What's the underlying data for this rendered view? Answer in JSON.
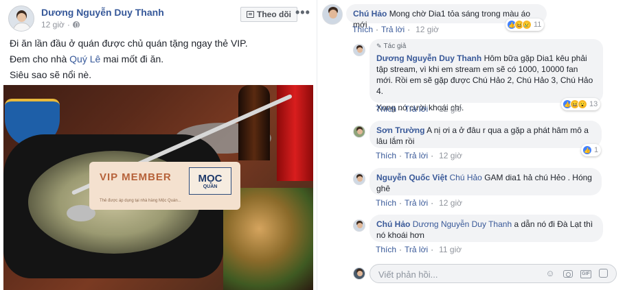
{
  "post": {
    "author": "Dương Nguyễn Duy Thanh",
    "time": "12 giờ",
    "privacy_icon": "globe-icon",
    "follow_label": "Theo dõi",
    "more_label": "•••",
    "line1": "Đi ăn lần đầu ở quán được chủ quán tặng ngay thẻ VIP.",
    "line2_prefix": "Đem cho nhà ",
    "line2_link": "Quý Lê",
    "line2_suffix": " mai mốt đi ăn.",
    "line3": "Siêu sao sẽ nổi nè.",
    "photo": {
      "card_title": "VIP MEMBER",
      "logo_line1": "MỌC",
      "logo_line2": "QUÁN",
      "card_small_text": "Thẻ được áp dụng tại nhà hàng Mộc Quán..."
    }
  },
  "comments": [
    {
      "name": "Chú Hảo",
      "text": "Mong chờ Dia1 tỏa sáng trong màu áo mới",
      "like": "Thích",
      "reply": "Trả lời",
      "time": "12 giờ",
      "reactions": [
        "like-icon",
        "haha-icon",
        "sad-icon"
      ],
      "reaction_count": "11"
    },
    {
      "badge": "Tác giả",
      "name": "Dương Nguyễn Duy Thanh",
      "text": "Hôm bữa gặp Dia1 kêu phải tập stream, vì khi em stream em sẽ có 1000, 10000 fan mới. Rồi em sẽ gặp được Chú Hảo 2, Chú Hảo 3, Chú Hảo 4.",
      "text2": "Xong nó cười khoái chí.",
      "like": "Thích",
      "reply": "Trả lời",
      "time": "12 giờ",
      "reactions": [
        "like-icon",
        "haha-icon",
        "wow-icon"
      ],
      "reaction_count": "13"
    },
    {
      "name": "Sơn Trường",
      "text": "A nị ơi a ở đâu r qua a gặp a phát hâm mô a lâu lắm rồi",
      "like": "Thích",
      "reply": "Trả lời",
      "time": "12 giờ",
      "reactions": [
        "like-icon"
      ],
      "reaction_count": "1"
    },
    {
      "name": "Nguyễn Quốc Việt",
      "tag": "Chú Hảo",
      "text": "GAM dia1 hả chú Hẻo . Hóng ghê",
      "like": "Thích",
      "reply": "Trả lời",
      "time": "12 giờ"
    },
    {
      "name": "Chú Hảo",
      "tag": "Dương Nguyễn Duy Thanh",
      "text": "a dẫn nó đi Đà Lạt thì nó khoái hơn",
      "like": "Thích",
      "reply": "Trả lời",
      "time": "11 giờ"
    }
  ],
  "reply_box": {
    "placeholder": "Viết phản hồi...",
    "tools": [
      "emoji-icon",
      "camera-icon",
      "gif-icon",
      "sticker-icon"
    ]
  },
  "colors": {
    "link": "#385898",
    "author": "#365899",
    "bubble_bg": "#f2f3f5",
    "like_blue": "#4080ff"
  }
}
